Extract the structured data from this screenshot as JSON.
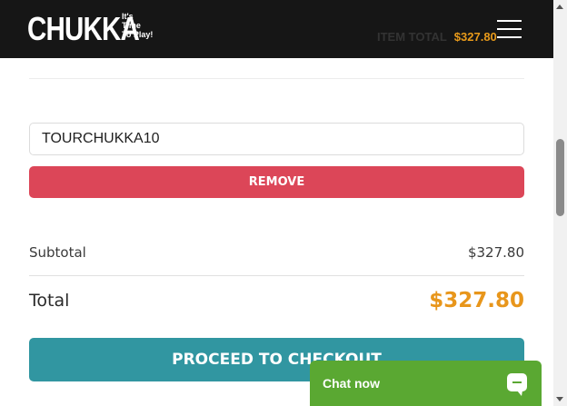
{
  "header": {
    "brand": "CHUKKA",
    "tagline": [
      "It's",
      "Time",
      "To Play!"
    ],
    "item_total_label": "ITEM TOTAL",
    "item_total_value": "$327.80",
    "menu_icon": "hamburger-menu-icon"
  },
  "coupon": {
    "value": "TOURCHUKKA10",
    "remove_label": "REMOVE"
  },
  "summary": {
    "subtotal_label": "Subtotal",
    "subtotal_value": "$327.80",
    "total_label": "Total",
    "total_value": "$327.80"
  },
  "checkout": {
    "label": "PROCEED TO CHECKOUT"
  },
  "chat": {
    "label": "Chat now",
    "icon": "chat-bubble-icon"
  },
  "colors": {
    "header_bg": "#161616",
    "remove": "#dc4658",
    "checkout": "#3196a1",
    "total_amount": "#e8961b",
    "chat": "#5aa832"
  }
}
